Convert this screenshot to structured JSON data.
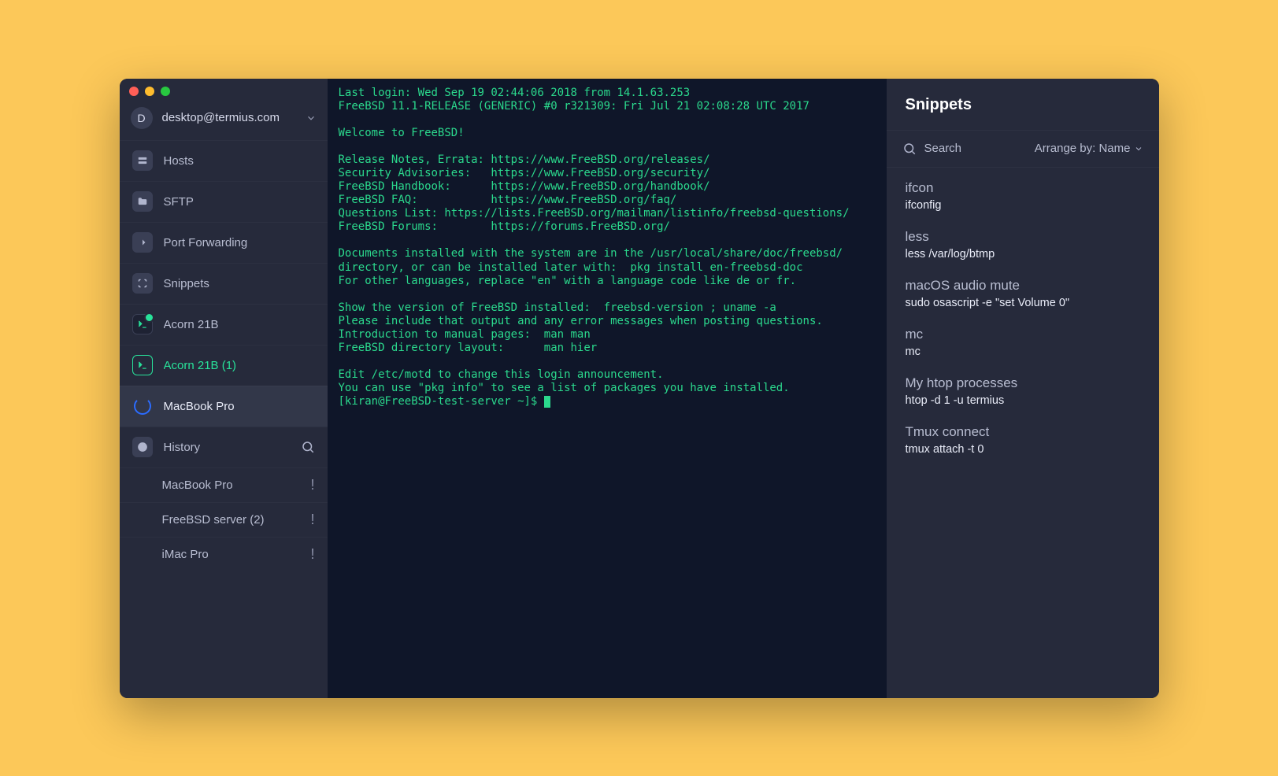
{
  "account": {
    "initial": "D",
    "label": "desktop@termius.com"
  },
  "sidebar": {
    "nav": [
      {
        "id": "hosts",
        "label": "Hosts"
      },
      {
        "id": "sftp",
        "label": "SFTP"
      },
      {
        "id": "portforwarding",
        "label": "Port Forwarding"
      },
      {
        "id": "snippets",
        "label": "Snippets"
      }
    ],
    "sessions": [
      {
        "id": "acorn21b",
        "label": "Acorn 21B",
        "state": "idle"
      },
      {
        "id": "acorn21b-1",
        "label": "Acorn 21B (1)",
        "state": "active"
      },
      {
        "id": "mbp",
        "label": "MacBook Pro",
        "state": "connecting"
      }
    ],
    "history_label": "History",
    "history": [
      {
        "label": "MacBook Pro"
      },
      {
        "label": "FreeBSD server (2)"
      },
      {
        "label": "iMac Pro"
      }
    ]
  },
  "terminal": {
    "lines": [
      "Last login: Wed Sep 19 02:44:06 2018 from 14.1.63.253",
      "FreeBSD 11.1-RELEASE (GENERIC) #0 r321309: Fri Jul 21 02:08:28 UTC 2017",
      "",
      "Welcome to FreeBSD!",
      "",
      "Release Notes, Errata: https://www.FreeBSD.org/releases/",
      "Security Advisories:   https://www.FreeBSD.org/security/",
      "FreeBSD Handbook:      https://www.FreeBSD.org/handbook/",
      "FreeBSD FAQ:           https://www.FreeBSD.org/faq/",
      "Questions List: https://lists.FreeBSD.org/mailman/listinfo/freebsd-questions/",
      "FreeBSD Forums:        https://forums.FreeBSD.org/",
      "",
      "Documents installed with the system are in the /usr/local/share/doc/freebsd/",
      "directory, or can be installed later with:  pkg install en-freebsd-doc",
      "For other languages, replace \"en\" with a language code like de or fr.",
      "",
      "Show the version of FreeBSD installed:  freebsd-version ; uname -a",
      "Please include that output and any error messages when posting questions.",
      "Introduction to manual pages:  man man",
      "FreeBSD directory layout:      man hier",
      "",
      "Edit /etc/motd to change this login announcement.",
      "You can use \"pkg info\" to see a list of packages you have installed."
    ],
    "prompt": "[kiran@FreeBSD-test-server ~]$ "
  },
  "panel": {
    "title": "Snippets",
    "search_placeholder": "Search",
    "arrange_label": "Arrange by: Name",
    "snippets": [
      {
        "title": "ifcon",
        "cmd": "ifconfig"
      },
      {
        "title": "less",
        "cmd": "less /var/log/btmp"
      },
      {
        "title": "macOS audio mute",
        "cmd": "sudo osascript -e \"set Volume 0\""
      },
      {
        "title": "mc",
        "cmd": "mc"
      },
      {
        "title": "My htop processes",
        "cmd": "htop -d 1 -u termius"
      },
      {
        "title": "Tmux connect",
        "cmd": "tmux attach -t 0"
      }
    ]
  }
}
